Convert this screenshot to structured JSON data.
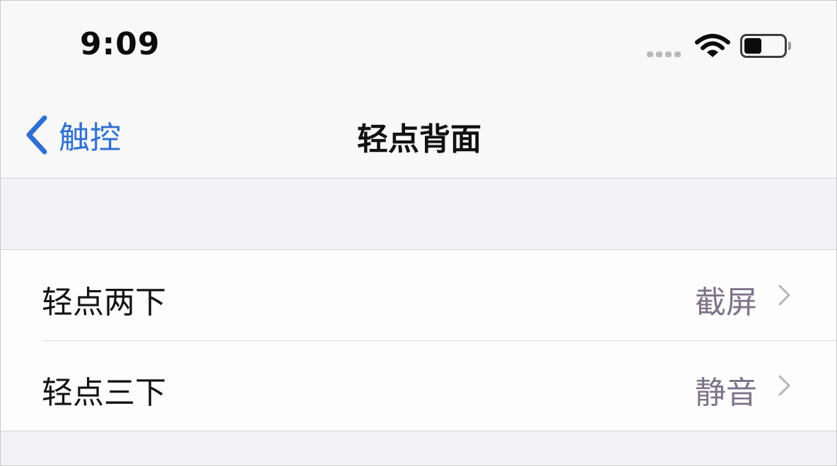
{
  "status_bar": {
    "time": "9:09",
    "battery_level": 0.45,
    "icons": [
      "cellular-signal-icon",
      "wifi-icon",
      "battery-icon"
    ]
  },
  "nav_bar": {
    "back_label": "触控",
    "title": "轻点背面",
    "back_icon": "chevron-left-icon"
  },
  "settings": {
    "rows": [
      {
        "label": "轻点两下",
        "value": "截屏"
      },
      {
        "label": "轻点三下",
        "value": "静音"
      }
    ]
  },
  "colors": {
    "accent": "#2f6fd1",
    "background": "#f2f2f7",
    "secondary_text": "#7e7489"
  }
}
